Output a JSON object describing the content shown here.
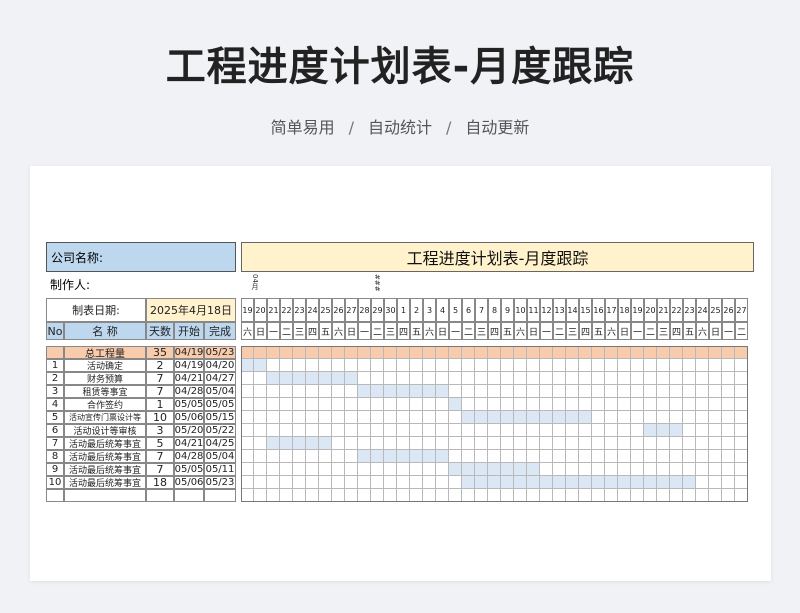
{
  "hero": {
    "title": "工程进度计划表-月度跟踪",
    "subtitle_parts": [
      "简单易用",
      "自动统计",
      "自动更新"
    ],
    "separator": "/"
  },
  "sheet": {
    "company_label": "公司名称:",
    "maker_label": "制作人:",
    "title": "工程进度计划表-月度跟踪",
    "date_label": "制表日期:",
    "date_value": "2025年4月18日",
    "headers": {
      "no": "No",
      "name": "名 称",
      "days": "天数",
      "start": "开始",
      "end": "完成"
    },
    "col_marks": [
      "04月",
      "###"
    ],
    "days": [
      "19",
      "20",
      "21",
      "22",
      "23",
      "24",
      "25",
      "26",
      "27",
      "28",
      "29",
      "30",
      "1",
      "2",
      "3",
      "4",
      "5",
      "6",
      "7",
      "8",
      "9",
      "10",
      "11",
      "12",
      "13",
      "14",
      "15",
      "16",
      "17",
      "18",
      "19",
      "20",
      "21",
      "22",
      "23",
      "24",
      "25",
      "26",
      "27"
    ],
    "weekdays": [
      "六",
      "日",
      "一",
      "二",
      "三",
      "四",
      "五",
      "六",
      "日",
      "一",
      "二",
      "三",
      "四",
      "五",
      "六",
      "日",
      "一",
      "二",
      "三",
      "四",
      "五",
      "六",
      "日",
      "一",
      "二",
      "三",
      "四",
      "五",
      "六",
      "日",
      "一",
      "二",
      "三",
      "四",
      "五",
      "六",
      "日",
      "一",
      "二"
    ],
    "total": {
      "name": "总工程量",
      "days": "35",
      "start": "04/19",
      "end": "05/23"
    },
    "rows": [
      {
        "no": "1",
        "name": "活动确定",
        "days": "2",
        "start": "04/19",
        "end": "04/20",
        "bar_start": 0,
        "bar_len": 2
      },
      {
        "no": "2",
        "name": "财务预算",
        "days": "7",
        "start": "04/21",
        "end": "04/27",
        "bar_start": 2,
        "bar_len": 7
      },
      {
        "no": "3",
        "name": "租赁等事宜",
        "days": "7",
        "start": "04/28",
        "end": "05/04",
        "bar_start": 9,
        "bar_len": 7
      },
      {
        "no": "4",
        "name": "合作签约",
        "days": "1",
        "start": "05/05",
        "end": "05/05",
        "bar_start": 16,
        "bar_len": 1
      },
      {
        "no": "5",
        "name": "活动宣传门票设计等",
        "days": "10",
        "start": "05/06",
        "end": "05/15",
        "bar_start": 17,
        "bar_len": 10
      },
      {
        "no": "6",
        "name": "活动设计等审核",
        "days": "3",
        "start": "05/20",
        "end": "05/22",
        "bar_start": 31,
        "bar_len": 3
      },
      {
        "no": "7",
        "name": "活动最后统筹事宜",
        "days": "5",
        "start": "04/21",
        "end": "04/25",
        "bar_start": 2,
        "bar_len": 5
      },
      {
        "no": "8",
        "name": "活动最后统筹事宜",
        "days": "7",
        "start": "04/28",
        "end": "05/04",
        "bar_start": 9,
        "bar_len": 7
      },
      {
        "no": "9",
        "name": "活动最后统筹事宜",
        "days": "7",
        "start": "05/05",
        "end": "05/11",
        "bar_start": 16,
        "bar_len": 7
      },
      {
        "no": "10",
        "name": "活动最后统筹事宜",
        "days": "18",
        "start": "05/06",
        "end": "05/23",
        "bar_start": 17,
        "bar_len": 18
      }
    ],
    "empty_rows": 1
  }
}
